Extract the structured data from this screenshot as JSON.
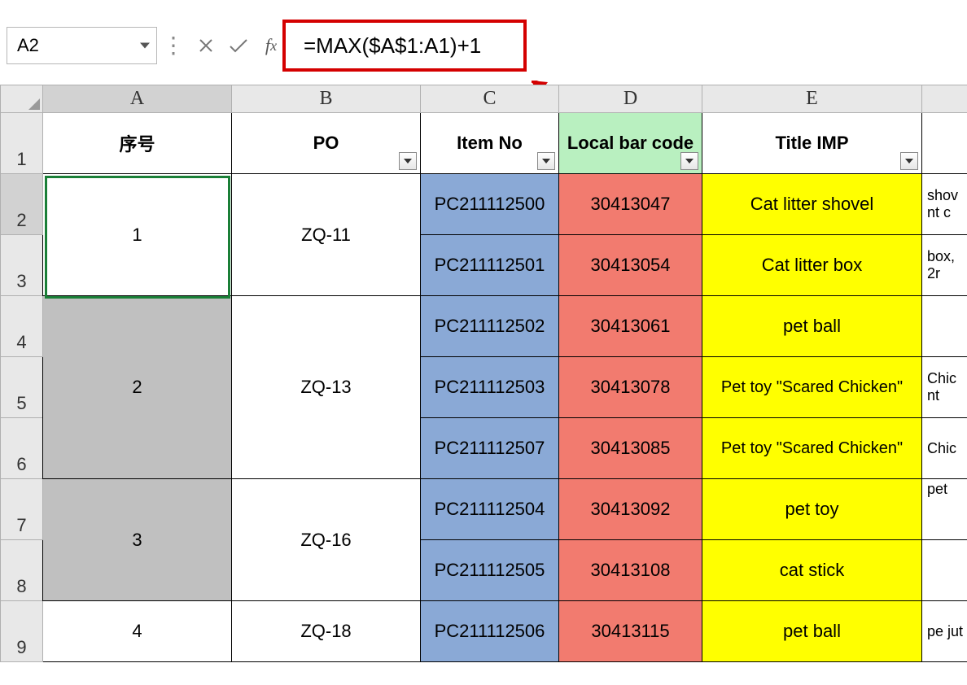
{
  "namebox": {
    "value": "A2"
  },
  "formula": {
    "value": "=MAX($A$1:A1)+1"
  },
  "columns": {
    "corner": "",
    "A": "A",
    "B": "B",
    "C": "C",
    "D": "D",
    "E": "E"
  },
  "headers": {
    "A": "序号",
    "B": "PO",
    "C": "Item No",
    "D": "Local bar code",
    "E": "Title IMP"
  },
  "rows": {
    "r1": "1",
    "r2": "2",
    "r3": "3",
    "r4": "4",
    "r5": "5",
    "r6": "6",
    "r7": "7",
    "r8": "8",
    "r9": "9"
  },
  "groups": [
    {
      "seq": "1",
      "po": "ZQ-11",
      "items": [
        {
          "item": "PC211112500",
          "bar": "30413047",
          "title": "Cat litter shovel",
          "f": "shov\nnt c"
        },
        {
          "item": "PC211112501",
          "bar": "30413054",
          "title": "Cat litter box",
          "f": "box,\n2r"
        }
      ]
    },
    {
      "seq": "2",
      "po": "ZQ-13",
      "items": [
        {
          "item": "PC211112502",
          "bar": "30413061",
          "title": "pet ball",
          "f": ""
        },
        {
          "item": "PC211112503",
          "bar": "30413078",
          "title": "Pet toy \"Scared Chicken\"",
          "f": "Chic\nnt"
        },
        {
          "item": "PC211112507",
          "bar": "30413085",
          "title": "Pet toy \"Scared Chicken\"",
          "f": "Chic"
        }
      ]
    },
    {
      "seq": "3",
      "po": "ZQ-16",
      "items": [
        {
          "item": "PC211112504",
          "bar": "30413092",
          "title": "pet toy",
          "f": "pet"
        },
        {
          "item": "PC211112505",
          "bar": "30413108",
          "title": "cat stick",
          "f": ""
        }
      ]
    },
    {
      "seq": "4",
      "po": "ZQ-18",
      "items": [
        {
          "item": "PC211112506",
          "bar": "30413115",
          "title": "pet ball",
          "f": "pe\njut"
        }
      ]
    }
  ],
  "colors": {
    "highlight_border": "#d40000",
    "blue": "#8aa9d6",
    "red": "#f27b6f",
    "yellow": "#ffff00",
    "green_header": "#b9f0c0"
  }
}
